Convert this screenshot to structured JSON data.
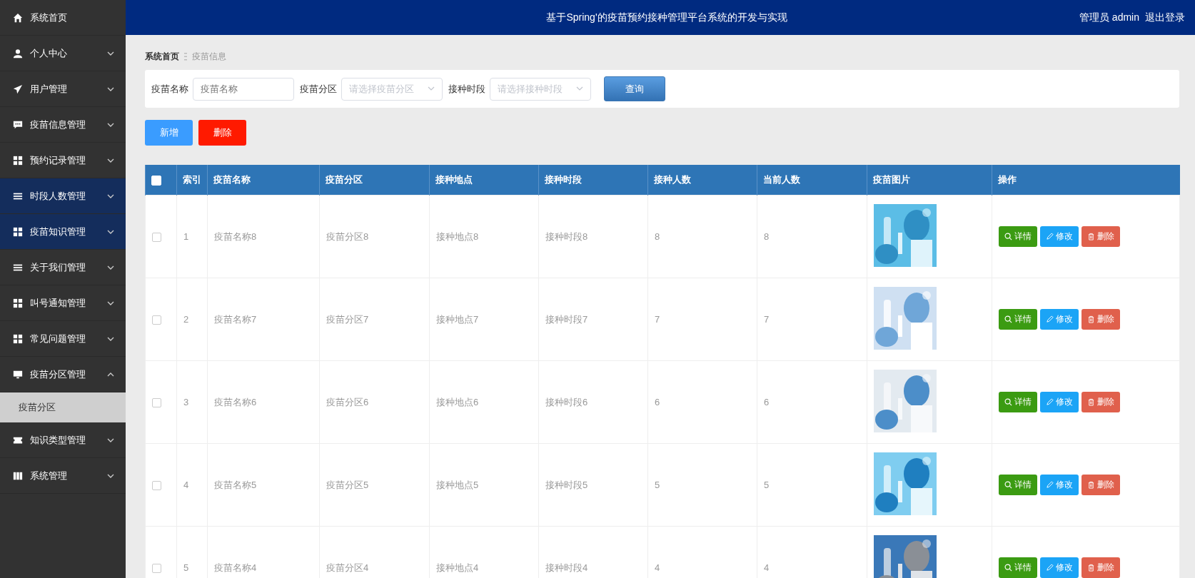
{
  "sidebar": {
    "items": [
      {
        "label": "系统首页",
        "kind": "link",
        "highlighted": false
      },
      {
        "label": "个人中心",
        "kind": "menu",
        "highlighted": false,
        "expanded": false
      },
      {
        "label": "用户管理",
        "kind": "menu",
        "highlighted": false,
        "expanded": false
      },
      {
        "label": "疫苗信息管理",
        "kind": "menu",
        "highlighted": false,
        "expanded": false
      },
      {
        "label": "预约记录管理",
        "kind": "menu",
        "highlighted": false,
        "expanded": false
      },
      {
        "label": "时段人数管理",
        "kind": "menu",
        "highlighted": true,
        "expanded": false
      },
      {
        "label": "疫苗知识管理",
        "kind": "menu",
        "highlighted": true,
        "expanded": false
      },
      {
        "label": "关于我们管理",
        "kind": "menu",
        "highlighted": false,
        "expanded": false
      },
      {
        "label": "叫号通知管理",
        "kind": "menu",
        "highlighted": false,
        "expanded": false
      },
      {
        "label": "常见问题管理",
        "kind": "menu",
        "highlighted": false,
        "expanded": false
      },
      {
        "label": "疫苗分区管理",
        "kind": "menu",
        "highlighted": false,
        "expanded": true,
        "children": [
          {
            "label": "疫苗分区",
            "selected": true
          }
        ]
      },
      {
        "label": "知识类型管理",
        "kind": "menu",
        "highlighted": false,
        "expanded": false
      },
      {
        "label": "系统管理",
        "kind": "menu",
        "highlighted": false,
        "expanded": false
      }
    ]
  },
  "header": {
    "title": "基于Spring'的疫苗预约接种管理平台系统的开发与实现",
    "user": "管理员 admin",
    "logout": "退出登录"
  },
  "breadcrumb": [
    "系统首页",
    "疫苗信息"
  ],
  "search": {
    "fields": [
      {
        "label": "疫苗名称",
        "kind": "input",
        "placeholder": "疫苗名称"
      },
      {
        "label": "疫苗分区",
        "kind": "select",
        "placeholder": "请选择疫苗分区"
      },
      {
        "label": "接种时段",
        "kind": "select",
        "placeholder": "请选择接种时段"
      }
    ],
    "button": "查询"
  },
  "actions": [
    {
      "label": "新增",
      "kind": "add"
    },
    {
      "label": "删除",
      "kind": "delete"
    }
  ],
  "table": {
    "select_all": {
      "checked": false
    },
    "columns": [
      "索引",
      "疫苗名称",
      "疫苗分区",
      "接种地点",
      "接种时段",
      "接种人数",
      "当前人数",
      "疫苗图片",
      "操作"
    ],
    "rows": [
      {
        "checked": false,
        "cells": [
          "1",
          "疫苗名称8",
          "疫苗分区8",
          "接种地点8",
          "接种时段8",
          "8",
          "8"
        ],
        "buttons": [
          "详情",
          "修改",
          "删除"
        ]
      },
      {
        "checked": false,
        "cells": [
          "2",
          "疫苗名称7",
          "疫苗分区7",
          "接种地点7",
          "接种时段7",
          "7",
          "7"
        ],
        "buttons": [
          "详情",
          "修改",
          "删除"
        ]
      },
      {
        "checked": false,
        "cells": [
          "3",
          "疫苗名称6",
          "疫苗分区6",
          "接种地点6",
          "接种时段6",
          "6",
          "6"
        ],
        "buttons": [
          "详情",
          "修改",
          "删除"
        ]
      },
      {
        "checked": false,
        "cells": [
          "4",
          "疫苗名称5",
          "疫苗分区5",
          "接种地点5",
          "接种时段5",
          "5",
          "5"
        ],
        "buttons": [
          "详情",
          "修改",
          "删除"
        ]
      },
      {
        "checked": false,
        "cells": [
          "5",
          "疫苗名称4",
          "疫苗分区4",
          "接种地点4",
          "接种时段4",
          "4",
          "4"
        ],
        "buttons": [
          "详情",
          "修改",
          "删除"
        ]
      }
    ]
  }
}
